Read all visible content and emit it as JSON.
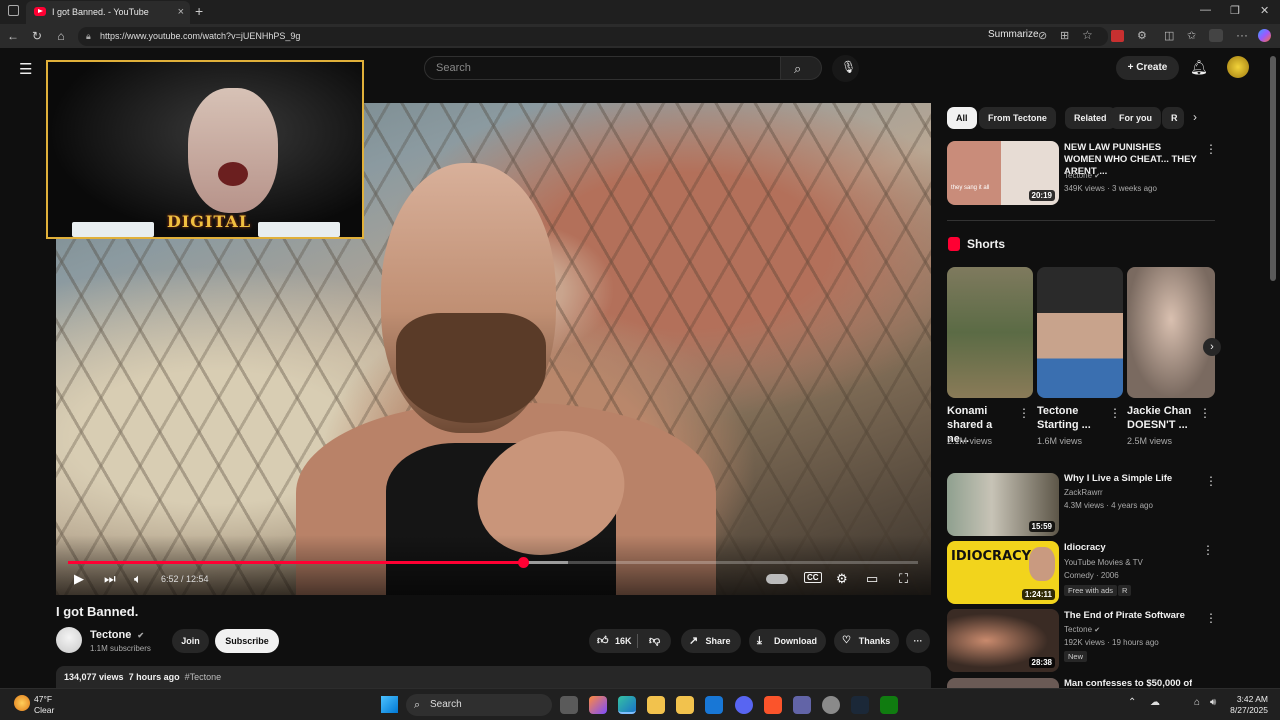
{
  "browser": {
    "tab_title": "I got Banned. - YouTube",
    "url": "https://www.youtube.com/watch?v=jUENHhPS_9g",
    "summarize_label": "Summarize",
    "new_tab": "+",
    "close_tab": "×"
  },
  "youtube": {
    "search_placeholder": "Search",
    "create_label": "+ Create"
  },
  "video": {
    "current_time": "6:52 / 12:54",
    "progress_fraction": 0.535,
    "webcam_logo_text": "DIGITAL"
  },
  "watch": {
    "title": "I got Banned.",
    "channel": "Tectone",
    "verified": "✔",
    "subscribers": "1.1M subscribers",
    "join_label": "Join",
    "subscribe_label": "Subscribe",
    "like_count": "16K",
    "share_label": "Share",
    "download_label": "Download",
    "thanks_label": "Thanks",
    "more_label": "···",
    "views": "134,077 views",
    "age": "7 hours ago",
    "hashtag": "#Tectone"
  },
  "sidebar": {
    "chips": [
      "All",
      "From Tectone",
      "Related",
      "For you",
      "R"
    ],
    "top_item": {
      "title": "NEW LAW PUNISHES WOMEN WHO CHEAT... THEY ARENT ...",
      "channel": "Tectone",
      "meta": "349K views · 3 weeks ago",
      "duration": "20:19",
      "thumb_caption": "they sang it all"
    },
    "shorts_heading": "Shorts",
    "shorts": [
      {
        "title": "Konami shared a ne...",
        "views": "2.1M views"
      },
      {
        "title": "Tectone Starting ...",
        "views": "1.6M views"
      },
      {
        "title": "Jackie Chan DOESN'T ...",
        "views": "2.5M views"
      }
    ],
    "items": [
      {
        "title": "Why I Live a Simple Life",
        "channel": "ZackRawrr",
        "meta": "4.3M views · 4 years ago",
        "duration": "15:59"
      },
      {
        "title": "Idiocracy",
        "channel": "YouTube Movies & TV",
        "meta": "Comedy · 2006",
        "badge": "Free with ads",
        "rating": "R",
        "duration": "1:24:11",
        "thumb_text": "IDIOCRACY"
      },
      {
        "title": "The End of Pirate Software",
        "channel": "Tectone",
        "meta": "192K views · 19 hours ago",
        "badge": "New",
        "duration": "28:38"
      },
      {
        "title": "Man confesses to $50,000 of"
      }
    ]
  },
  "taskbar": {
    "weather_temp": "47°F",
    "weather_desc": "Clear",
    "search_label": "Search",
    "time": "3:42 AM",
    "date": "8/27/2025"
  },
  "colors": {
    "accent_red": "#ff0033",
    "background": "#0f0f0f",
    "chip_bg": "#272727",
    "webcam_border": "#e0b03a"
  }
}
